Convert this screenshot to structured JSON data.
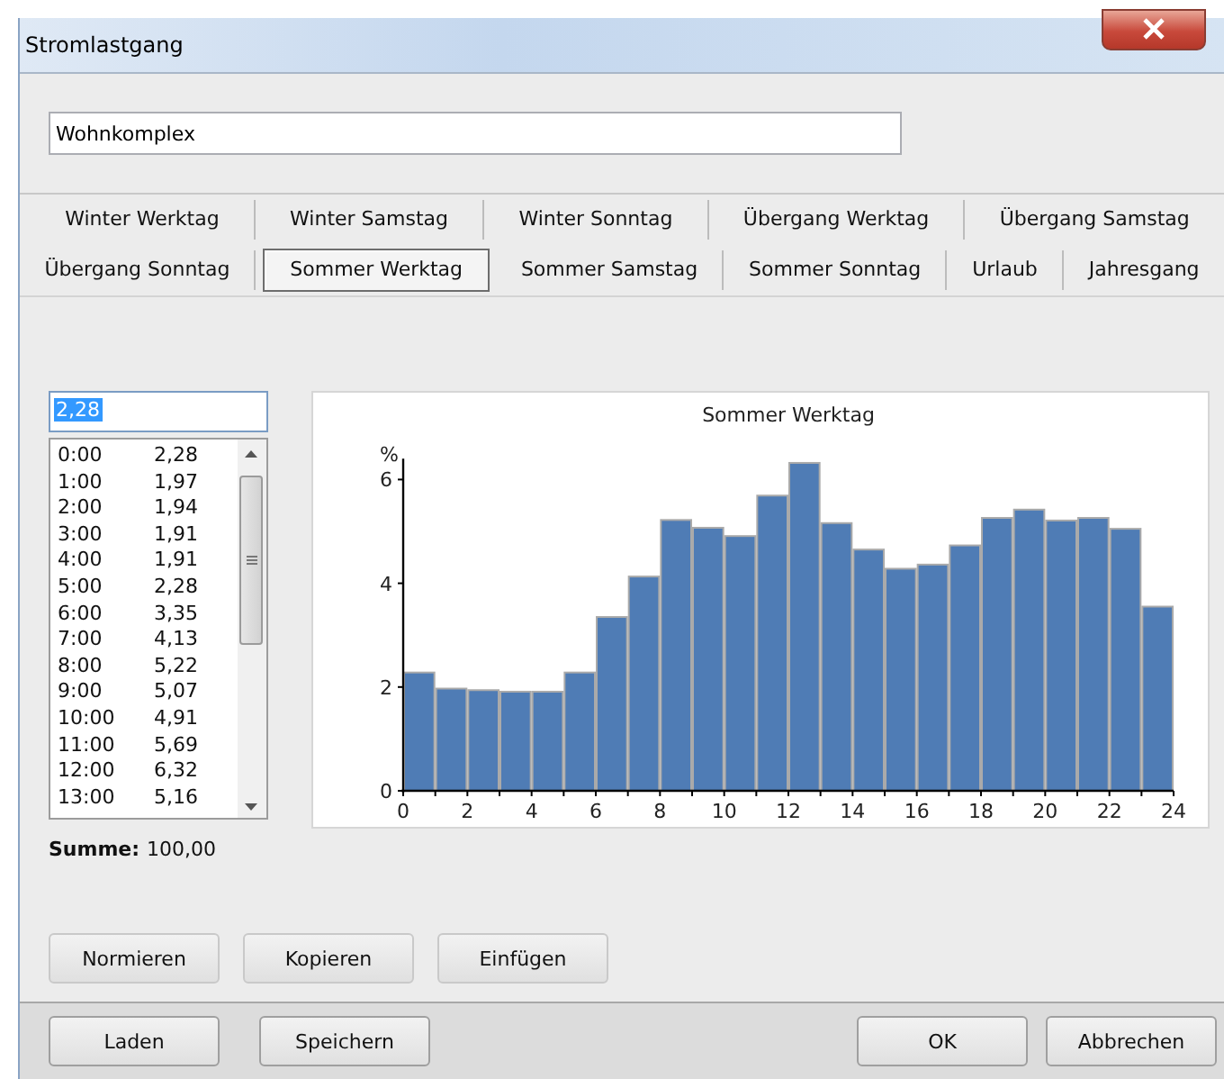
{
  "window": {
    "title": "Stromlastgang"
  },
  "name_field": {
    "value": "Wohnkomplex"
  },
  "tab_rows": [
    {
      "tabs": [
        {
          "label": "Winter Werktag",
          "selected": false
        },
        {
          "label": "Winter Samstag",
          "selected": false
        },
        {
          "label": "Winter Sonntag",
          "selected": false
        },
        {
          "label": "Übergang Werktag",
          "selected": false
        },
        {
          "label": "Übergang Samstag",
          "selected": false
        }
      ]
    },
    {
      "tabs": [
        {
          "label": "Übergang Sonntag",
          "selected": false
        },
        {
          "label": "Sommer Werktag",
          "selected": true
        },
        {
          "label": "Sommer Samstag",
          "selected": false
        },
        {
          "label": "Sommer Sonntag",
          "selected": false
        },
        {
          "label": "Urlaub",
          "selected": false
        },
        {
          "label": "Jahresgang",
          "selected": false
        }
      ]
    }
  ],
  "value_field": {
    "value": "2,28",
    "text_selected": true
  },
  "hour_list": [
    {
      "time": "0:00",
      "value": "2,28"
    },
    {
      "time": "1:00",
      "value": "1,97"
    },
    {
      "time": "2:00",
      "value": "1,94"
    },
    {
      "time": "3:00",
      "value": "1,91"
    },
    {
      "time": "4:00",
      "value": "1,91"
    },
    {
      "time": "5:00",
      "value": "2,28"
    },
    {
      "time": "6:00",
      "value": "3,35"
    },
    {
      "time": "7:00",
      "value": "4,13"
    },
    {
      "time": "8:00",
      "value": "5,22"
    },
    {
      "time": "9:00",
      "value": "5,07"
    },
    {
      "time": "10:00",
      "value": "4,91"
    },
    {
      "time": "11:00",
      "value": "5,69"
    },
    {
      "time": "12:00",
      "value": "6,32"
    },
    {
      "time": "13:00",
      "value": "5,16"
    }
  ],
  "sum": {
    "label": "Summe:",
    "value": "100,00"
  },
  "chart": {
    "chart_data": {
      "type": "bar",
      "title": "Sommer Werktag",
      "ylabel": "%",
      "x": [
        0.5,
        1.5,
        2.5,
        3.5,
        4.5,
        5.5,
        6.5,
        7.5,
        8.5,
        9.5,
        10.5,
        11.5,
        12.5,
        13.5,
        14.5,
        15.5,
        16.5,
        17.5,
        18.5,
        19.5,
        20.5,
        21.5,
        22.5,
        23.5
      ],
      "values": [
        2.28,
        1.97,
        1.94,
        1.91,
        1.91,
        2.28,
        3.35,
        4.13,
        5.22,
        5.07,
        4.91,
        5.69,
        6.32,
        5.16,
        4.65,
        4.28,
        4.36,
        4.73,
        5.26,
        5.42,
        5.21,
        5.26,
        5.05,
        3.55
      ],
      "xlim": [
        0,
        24
      ],
      "ylim": [
        0,
        6.4
      ],
      "xticks": [
        0,
        2,
        4,
        6,
        8,
        10,
        12,
        14,
        16,
        18,
        20,
        22,
        24
      ],
      "yticks": [
        0,
        2,
        4,
        6
      ]
    }
  },
  "edit_buttons": [
    "Normieren",
    "Kopieren",
    "Einfügen"
  ],
  "footer_left": [
    "Laden",
    "Speichern"
  ],
  "footer_right": [
    "OK",
    "Abbrechen"
  ]
}
